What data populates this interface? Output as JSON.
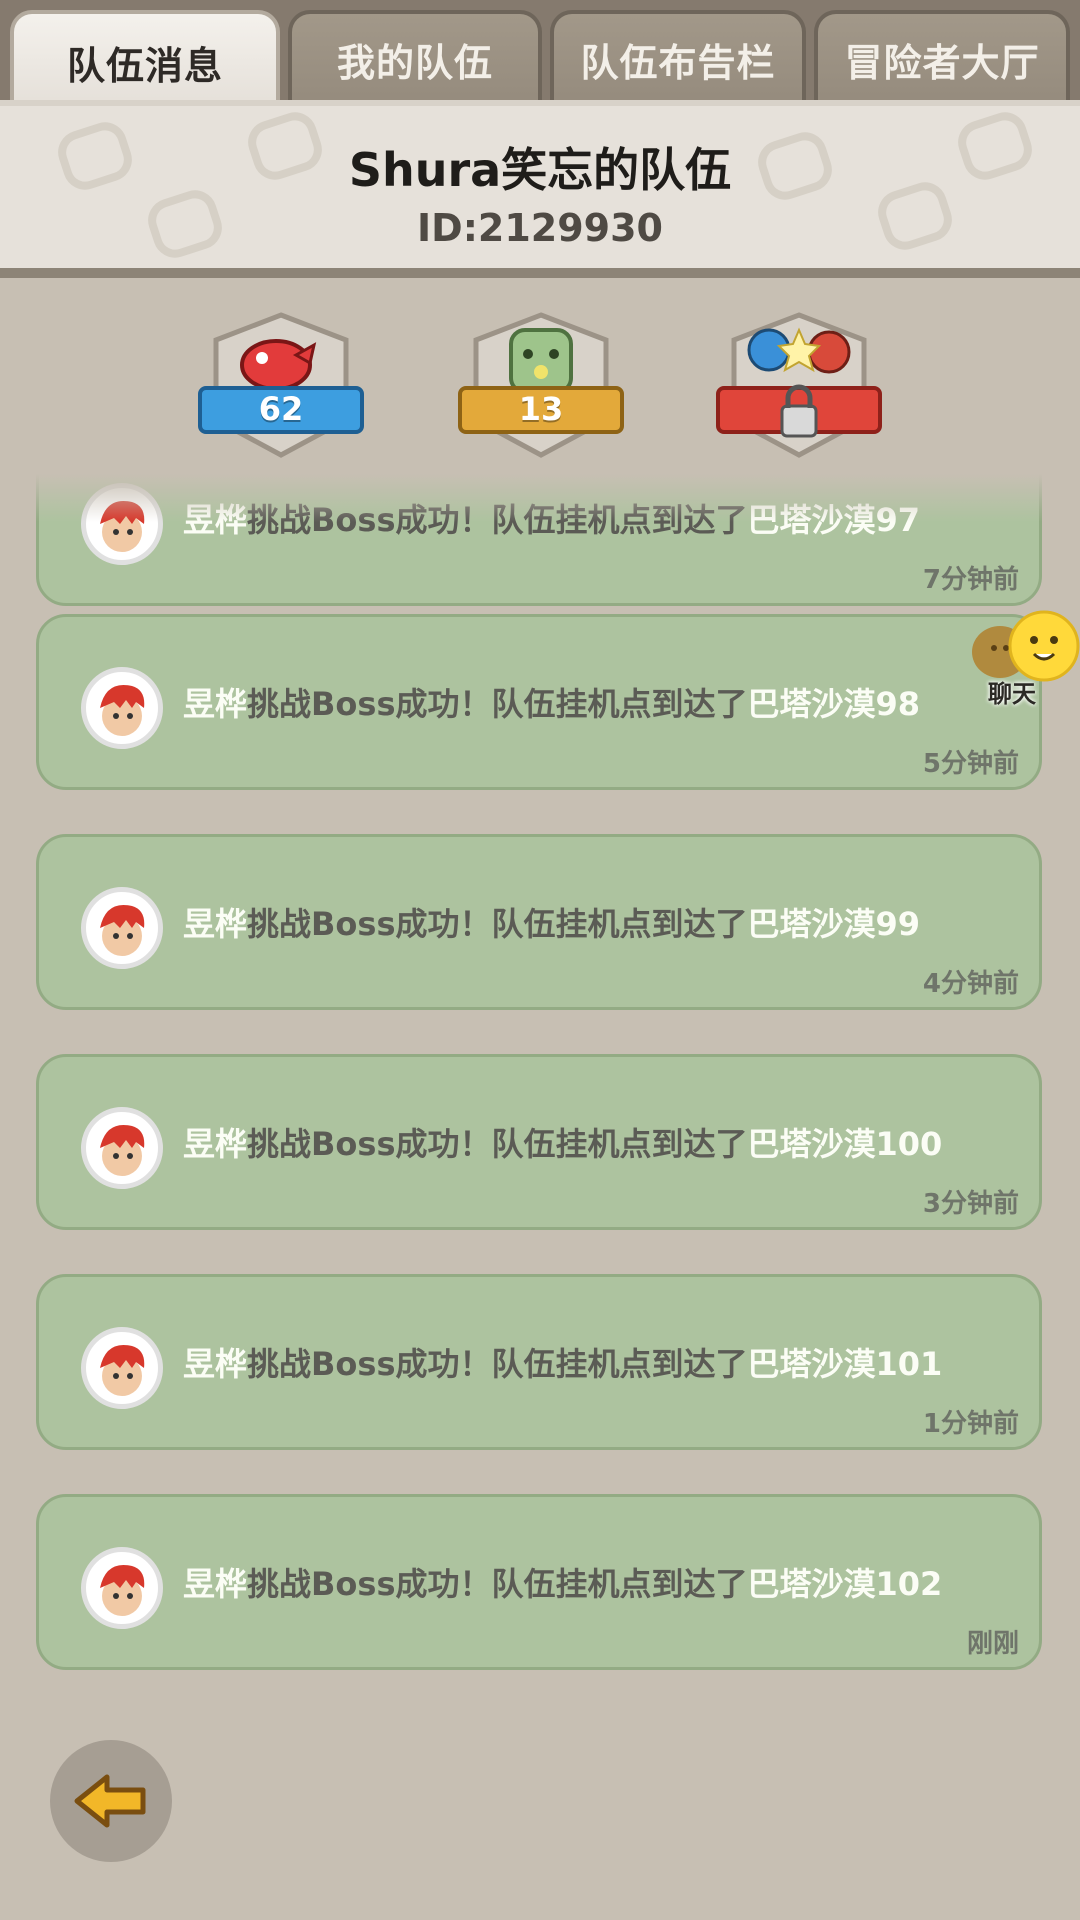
{
  "tabs": [
    {
      "label": "队伍消息",
      "active": true
    },
    {
      "label": "我的队伍",
      "active": false
    },
    {
      "label": "队伍布告栏",
      "active": false
    },
    {
      "label": "冒险者大厅",
      "active": false
    }
  ],
  "header": {
    "team_name": "Shura笑忘的队伍",
    "team_id": "ID:2129930"
  },
  "badges": [
    {
      "icon": "red-dragon-icon",
      "value": "62",
      "ribbon_color": "#3d9ee0"
    },
    {
      "icon": "green-golem-icon",
      "value": "13",
      "ribbon_color": "#e3a93a"
    },
    {
      "icon": "duel-heroes-icon",
      "locked": true,
      "ribbon_color": "#e0453a"
    }
  ],
  "messages": [
    {
      "name": "昱桦",
      "text": "挑战Boss成功！队伍挂机点到达了",
      "place": "巴塔沙漠97",
      "time": "7分钟前"
    },
    {
      "name": "昱桦",
      "text": "挑战Boss成功！队伍挂机点到达了",
      "place": "巴塔沙漠98",
      "time": "5分钟前"
    },
    {
      "name": "昱桦",
      "text": "挑战Boss成功！队伍挂机点到达了",
      "place": "巴塔沙漠99",
      "time": "4分钟前"
    },
    {
      "name": "昱桦",
      "text": "挑战Boss成功！队伍挂机点到达了",
      "place": "巴塔沙漠100",
      "time": "3分钟前"
    },
    {
      "name": "昱桦",
      "text": "挑战Boss成功！队伍挂机点到达了",
      "place": "巴塔沙漠101",
      "time": "1分钟前"
    },
    {
      "name": "昱桦",
      "text": "挑战Boss成功！队伍挂机点到达了",
      "place": "巴塔沙漠102",
      "time": "刚刚"
    }
  ],
  "chat": {
    "label": "聊天"
  },
  "back": {
    "icon": "back-arrow-icon"
  },
  "colors": {
    "card": "#adc39f",
    "highlight": "#fbfdf5",
    "background": "#c7bfb3"
  }
}
